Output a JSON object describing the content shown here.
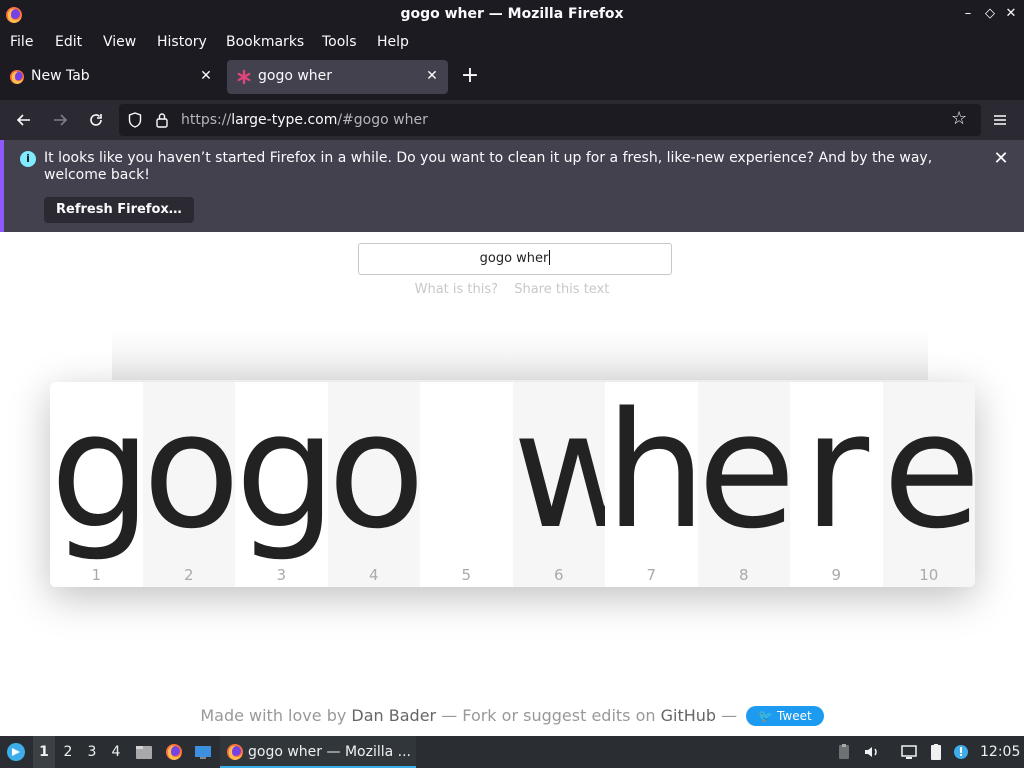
{
  "window": {
    "title": "gogo wher — Mozilla Firefox",
    "controls": {
      "minimize": "–",
      "maximize": "◇",
      "close": "✕"
    }
  },
  "menubar": [
    "File",
    "Edit",
    "View",
    "History",
    "Bookmarks",
    "Tools",
    "Help"
  ],
  "tabs": [
    {
      "label": "New Tab",
      "active": false,
      "icon": "firefox-icon"
    },
    {
      "label": "gogo wher",
      "active": true,
      "icon": "large-type-favicon"
    }
  ],
  "new_tab_button": "+",
  "navbar": {
    "url_prefix": "https://",
    "url_host": "large-type.com",
    "url_rest": "/#gogo wher"
  },
  "notification": {
    "message": "It looks like you haven’t started Firefox in a while. Do you want to clean it up for a fresh, like-new experience? And by the way, welcome back!",
    "button": "Refresh Firefox…",
    "accent_color": "#9059ff",
    "info_color": "#80ebff"
  },
  "page": {
    "input_value": "gogo wher",
    "links": [
      "What is this?",
      "Share this text"
    ],
    "characters": [
      {
        "char": "g",
        "index": "1"
      },
      {
        "char": "o",
        "index": "2"
      },
      {
        "char": "g",
        "index": "3"
      },
      {
        "char": "o",
        "index": "4"
      },
      {
        "char": " ",
        "index": "5"
      },
      {
        "char": "w",
        "index": "6"
      },
      {
        "char": "h",
        "index": "7"
      },
      {
        "char": "e",
        "index": "8"
      },
      {
        "char": "r",
        "index": "9"
      },
      {
        "char": "e",
        "index": "10"
      }
    ],
    "footer": {
      "made_with": "Made with love by",
      "author": "Dan Bader",
      "fork_text": "— Fork or suggest edits on",
      "github": "GitHub",
      "dash": "—",
      "tweet": "Tweet"
    }
  },
  "taskbar": {
    "workspaces": [
      "1",
      "2",
      "3",
      "4"
    ],
    "active_workspace": "1",
    "window_label": "gogo wher — Mozilla ...",
    "clock": "12:05",
    "accent_color": "#3daee9"
  }
}
